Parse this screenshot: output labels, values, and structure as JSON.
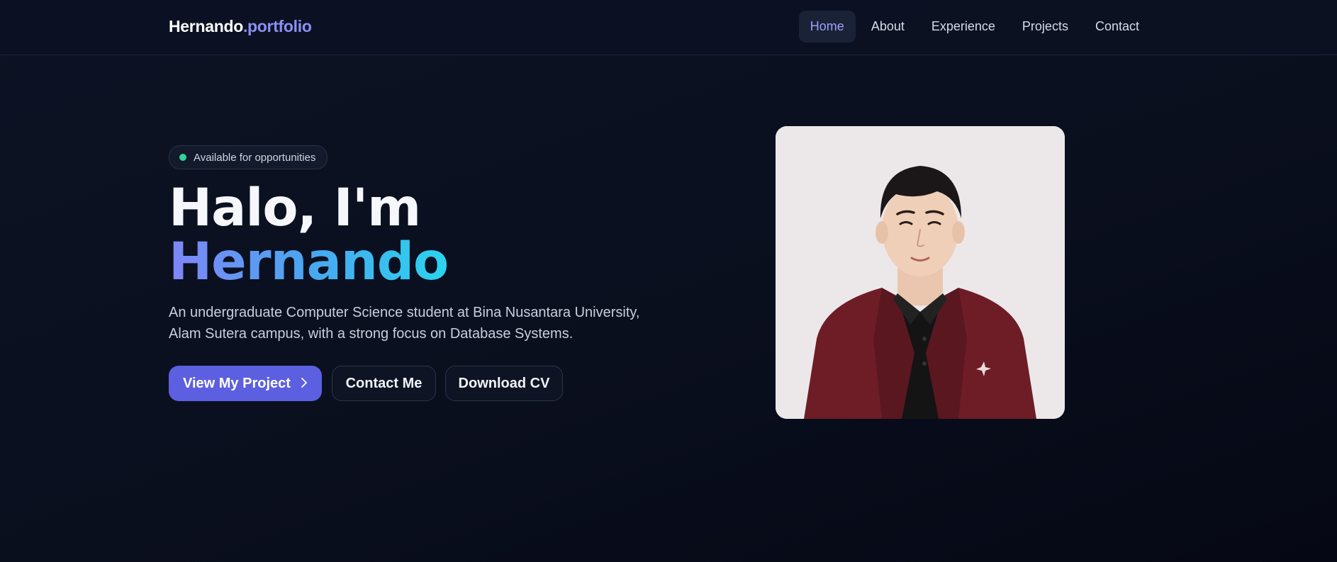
{
  "nav": {
    "logo_name": "Hernando",
    "logo_suffix": ".portfolio",
    "links": [
      {
        "label": "Home",
        "active": true
      },
      {
        "label": "About",
        "active": false
      },
      {
        "label": "Experience",
        "active": false
      },
      {
        "label": "Projects",
        "active": false
      },
      {
        "label": "Contact",
        "active": false
      }
    ]
  },
  "hero": {
    "badge": "Available for opportunities",
    "title_line1": "Halo, I'm",
    "title_line2": "Hernando",
    "description": "An undergraduate Computer Science student at Bina Nusantara University, Alam Sutera campus, with a strong focus on Database Systems.",
    "primary_button": "View My Project",
    "primary_button_icon": "chevron-right-icon",
    "contact_button": "Contact Me",
    "cv_button": "Download CV"
  },
  "colors": {
    "background": "#0a0f1e",
    "accent": "#5b5fe0",
    "logo_accent": "#8b8ff5",
    "status_dot": "#2fd596",
    "gradient_start": "#7f86f6",
    "gradient_end": "#2ad4ee"
  }
}
